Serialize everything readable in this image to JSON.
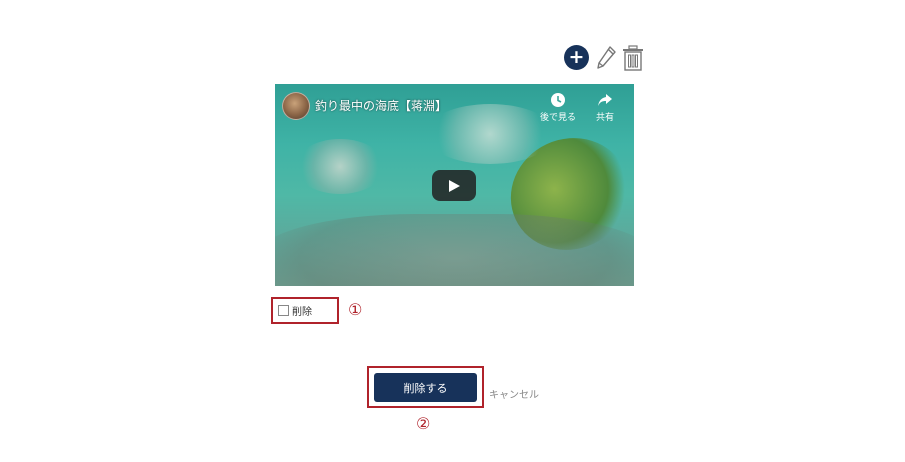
{
  "toolbar": {
    "add_icon": "plus-icon",
    "edit_icon": "pencil-icon",
    "delete_icon": "trash-icon",
    "add_symbol": "+"
  },
  "video": {
    "title": "釣り最中の海底【蒋淵】",
    "watch_later": "後で見る",
    "share": "共有"
  },
  "delete_option": {
    "label": "削除",
    "annotation": "①"
  },
  "actions": {
    "submit_label": "削除する",
    "cancel_label": "キャンセル",
    "annotation": "②"
  },
  "colors": {
    "primary": "#17325a",
    "highlight": "#b0232b"
  }
}
